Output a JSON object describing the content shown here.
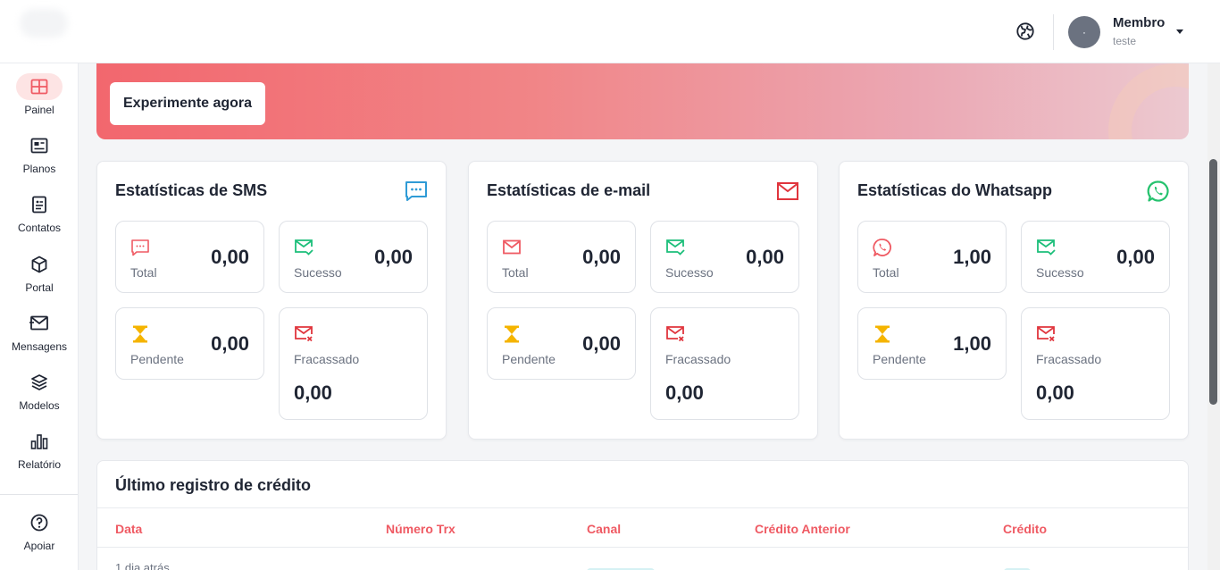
{
  "header": {
    "globe_icon": "globe-icon",
    "user": {
      "name": "Membro",
      "subtitle": "teste"
    }
  },
  "sidebar": {
    "items": [
      {
        "label": "Painel",
        "icon": "dashboard-grid-icon",
        "active": true
      },
      {
        "label": "Planos",
        "icon": "plans-icon",
        "active": false
      },
      {
        "label": "Contatos",
        "icon": "contacts-icon",
        "active": false
      },
      {
        "label": "Portal",
        "icon": "gateway-cube-icon",
        "active": false
      },
      {
        "label": "Mensagens",
        "icon": "messages-icon",
        "active": false
      },
      {
        "label": "Modelos",
        "icon": "layers-icon",
        "active": false
      },
      {
        "label": "Relatório",
        "icon": "bar-chart-icon",
        "active": false
      }
    ],
    "support": {
      "label": "Apoiar",
      "icon": "help-circle-icon"
    }
  },
  "banner": {
    "button_label": "Experimente agora"
  },
  "stats": [
    {
      "title": "Estatísticas de SMS",
      "icon": "sms-chat-icon",
      "accent": "#2f9bd6",
      "total": {
        "label": "Total",
        "value": "0,00"
      },
      "success": {
        "label": "Sucesso",
        "value": "0,00"
      },
      "pending": {
        "label": "Pendente",
        "value": "0,00"
      },
      "failed": {
        "label": "Fracassado",
        "value": "0,00"
      }
    },
    {
      "title": "Estatísticas de e-mail",
      "icon": "envelope-icon",
      "accent": "#e0353d",
      "total": {
        "label": "Total",
        "value": "0,00"
      },
      "success": {
        "label": "Sucesso",
        "value": "0,00"
      },
      "pending": {
        "label": "Pendente",
        "value": "0,00"
      },
      "failed": {
        "label": "Fracassado",
        "value": "0,00"
      }
    },
    {
      "title": "Estatísticas do Whatsapp",
      "icon": "whatsapp-icon",
      "accent": "#25c26e",
      "total": {
        "label": "Total",
        "value": "1,00"
      },
      "success": {
        "label": "Sucesso",
        "value": "0,00"
      },
      "pending": {
        "label": "Pendente",
        "value": "1,00"
      },
      "failed": {
        "label": "Fracassado",
        "value": "0,00"
      }
    }
  ],
  "credit_log": {
    "title": "Último registro de crédito",
    "columns": [
      "Data",
      "Número Trx",
      "Canal",
      "Crédito Anterior",
      "Crédito"
    ],
    "rows": [
      {
        "date": "1 dia atrás"
      }
    ]
  },
  "colors": {
    "accent": "#ef5a63",
    "success": "#1cbf7a",
    "pending": "#f5b400",
    "failed": "#e0353d"
  }
}
